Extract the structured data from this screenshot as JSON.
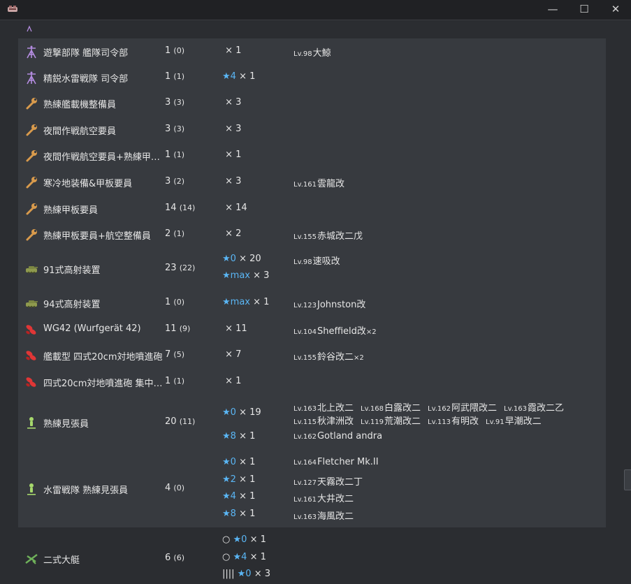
{
  "window": {
    "minimize": "—",
    "maximize": "☐",
    "close": "✕"
  },
  "rows": [
    {
      "icon": "antenna-icon",
      "name": "遊撃部隊 艦隊司令部",
      "count": "1",
      "sub": "(0)",
      "levels": [
        {
          "star": "",
          "mult": "× 1"
        }
      ],
      "ships": [
        [
          {
            "lv": "Lv.98",
            "name": "大鯨",
            "mult": ""
          }
        ]
      ]
    },
    {
      "icon": "antenna-icon",
      "name": "精鋭水雷戦隊 司令部",
      "count": "1",
      "sub": "(1)",
      "levels": [
        {
          "star": "★4",
          "mult": "× 1"
        }
      ],
      "ships": []
    },
    {
      "icon": "wrench-icon",
      "name": "熟練艦載機整備員",
      "count": "3",
      "sub": "(3)",
      "levels": [
        {
          "star": "",
          "mult": "× 3"
        }
      ],
      "ships": []
    },
    {
      "icon": "wrench-icon",
      "name": "夜間作戦航空要員",
      "count": "3",
      "sub": "(3)",
      "levels": [
        {
          "star": "",
          "mult": "× 3"
        }
      ],
      "ships": []
    },
    {
      "icon": "wrench-icon",
      "name": "夜間作戦航空要員+熟練甲…",
      "count": "1",
      "sub": "(1)",
      "levels": [
        {
          "star": "",
          "mult": "× 1"
        }
      ],
      "ships": []
    },
    {
      "icon": "wrench-icon",
      "name": "寒冷地装備&甲板要員",
      "count": "3",
      "sub": "(2)",
      "levels": [
        {
          "star": "",
          "mult": "× 3"
        }
      ],
      "ships": [
        [
          {
            "lv": "Lv.161",
            "name": "雲龍改",
            "mult": ""
          }
        ]
      ]
    },
    {
      "icon": "wrench-icon",
      "name": "熟練甲板要員",
      "count": "14",
      "sub": "(14)",
      "levels": [
        {
          "star": "",
          "mult": "× 14"
        }
      ],
      "ships": []
    },
    {
      "icon": "wrench-icon",
      "name": "熟練甲板要員+航空整備員",
      "count": "2",
      "sub": "(1)",
      "levels": [
        {
          "star": "",
          "mult": "× 2"
        }
      ],
      "ships": [
        [
          {
            "lv": "Lv.155",
            "name": "赤城改二戊",
            "mult": ""
          }
        ]
      ]
    },
    {
      "icon": "tank-icon",
      "name": "91式高射装置",
      "count": "23",
      "sub": "(22)",
      "levels": [
        {
          "star": "★0",
          "mult": "× 20"
        },
        {
          "star": "★max",
          "mult": "× 3"
        }
      ],
      "ships": [
        [
          {
            "lv": "Lv.98",
            "name": "速吸改",
            "mult": ""
          }
        ],
        []
      ]
    },
    {
      "icon": "tank-icon",
      "name": "94式高射装置",
      "count": "1",
      "sub": "(0)",
      "levels": [
        {
          "star": "★max",
          "mult": "× 1"
        }
      ],
      "ships": [
        [
          {
            "lv": "Lv.123",
            "name": "Johnston改",
            "mult": ""
          }
        ]
      ]
    },
    {
      "icon": "rocket-icon",
      "name": "WG42 (Wurfgerät 42)",
      "count": "11",
      "sub": "(9)",
      "levels": [
        {
          "star": "",
          "mult": "× 11"
        }
      ],
      "ships": [
        [
          {
            "lv": "Lv.104",
            "name": "Sheffield改",
            "mult": "×2"
          }
        ]
      ]
    },
    {
      "icon": "rocket-icon",
      "name": "艦載型 四式20cm対地噴進砲",
      "count": "7",
      "sub": "(5)",
      "levels": [
        {
          "star": "",
          "mult": "× 7"
        }
      ],
      "ships": [
        [
          {
            "lv": "Lv.155",
            "name": "鈴谷改二",
            "mult": "×2"
          }
        ]
      ]
    },
    {
      "icon": "rocket-icon",
      "name": "四式20cm対地噴進砲 集中…",
      "count": "1",
      "sub": "(1)",
      "levels": [
        {
          "star": "",
          "mult": "× 1"
        }
      ],
      "ships": []
    },
    {
      "icon": "lookout-icon",
      "name": "熟練見張員",
      "count": "20",
      "sub": "(11)",
      "levels": [
        {
          "star": "★0",
          "mult": "× 19"
        },
        {
          "star": "★8",
          "mult": "× 1"
        }
      ],
      "ships": [
        [
          {
            "lv": "Lv.163",
            "name": "北上改二",
            "mult": ""
          },
          {
            "lv": "Lv.168",
            "name": "白露改二",
            "mult": ""
          },
          {
            "lv": "Lv.162",
            "name": "阿武隈改二",
            "mult": ""
          },
          {
            "lv": "Lv.163",
            "name": "霞改二乙",
            "mult": ""
          }
        ],
        [
          {
            "lv": "Lv.115",
            "name": "秋津洲改",
            "mult": ""
          },
          {
            "lv": "Lv.119",
            "name": "荒潮改二",
            "mult": ""
          },
          {
            "lv": "Lv.113",
            "name": "有明改",
            "mult": ""
          },
          {
            "lv": "Lv.91",
            "name": "早潮改二",
            "mult": ""
          }
        ],
        [
          {
            "lv": "Lv.162",
            "name": "Gotland andra",
            "mult": ""
          }
        ]
      ]
    },
    {
      "icon": "lookout-icon",
      "name": "水雷戦隊 熟練見張員",
      "count": "4",
      "sub": "(0)",
      "levels": [
        {
          "star": "★0",
          "mult": "× 1"
        },
        {
          "star": "★2",
          "mult": "× 1"
        },
        {
          "star": "★4",
          "mult": "× 1"
        },
        {
          "star": "★8",
          "mult": "× 1"
        }
      ],
      "ships": [
        [
          {
            "lv": "Lv.164",
            "name": "Fletcher Mk.II",
            "mult": ""
          }
        ],
        [
          {
            "lv": "Lv.127",
            "name": "天霧改二丁",
            "mult": ""
          }
        ],
        [
          {
            "lv": "Lv.161",
            "name": "大井改二",
            "mult": ""
          }
        ],
        [
          {
            "lv": "Lv.163",
            "name": "海風改二",
            "mult": ""
          }
        ]
      ]
    },
    {
      "icon": "flyingboat-icon",
      "name": "二式大艇",
      "count": "6",
      "sub": "(6)",
      "levels": [
        {
          "prefix": "○",
          "star": "★0",
          "mult": "× 1"
        },
        {
          "prefix": "○",
          "star": "★4",
          "mult": "× 1"
        },
        {
          "prefix": "||||",
          "star": "★0",
          "mult": "× 3"
        }
      ],
      "ships": []
    }
  ]
}
